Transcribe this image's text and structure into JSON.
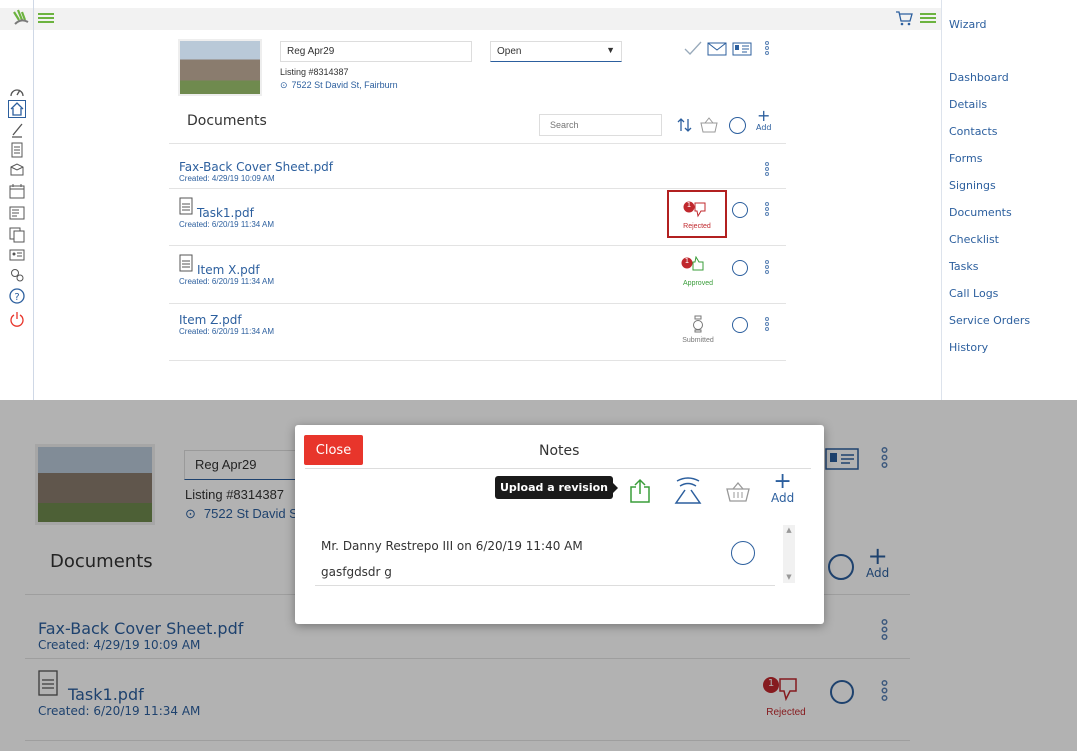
{
  "top": {
    "right_nav": [
      "Wizard",
      "Dashboard",
      "Details",
      "Contacts",
      "Forms",
      "Signings",
      "Documents",
      "Checklist",
      "Tasks",
      "Call Logs",
      "Service Orders",
      "History"
    ],
    "listing": {
      "name": "Reg Apr29",
      "status": "Open",
      "number": "Listing #8314387",
      "address": "7522 St David St, Fairburn"
    },
    "section_title": "Documents",
    "search_placeholder": "Search",
    "add_label": "Add",
    "documents": [
      {
        "title": "Fax-Back Cover Sheet.pdf",
        "created": "Created: 4/29/19 10:09 AM"
      },
      {
        "title": "Task1.pdf",
        "created": "Created: 6/20/19 11:34 AM",
        "status": "Rejected",
        "badge": "1"
      },
      {
        "title": "Item X.pdf",
        "created": "Created: 6/20/19 11:34 AM",
        "status": "Approved",
        "badge": "1"
      },
      {
        "title": "Item Z.pdf",
        "created": "Created: 6/20/19 11:34 AM",
        "status": "Submitted"
      }
    ]
  },
  "bottom": {
    "listing": {
      "name": "Reg Apr29",
      "number": "Listing #8314387",
      "address": "7522 St David S"
    },
    "section_title": "Documents",
    "add_label": "Add",
    "documents": [
      {
        "title": "Fax-Back Cover Sheet.pdf",
        "created": "Created: 4/29/19 10:09 AM"
      },
      {
        "title": "Task1.pdf",
        "created": "Created: 6/20/19 11:34 AM",
        "status": "Rejected",
        "badge": "1"
      }
    ],
    "modal": {
      "close_label": "Close",
      "title": "Notes",
      "tooltip": "Upload a revision",
      "add_label": "Add",
      "note_author": "Mr. Danny Restrepo III on 6/20/19 11:40 AM",
      "note_text": "gasfgdsdr g"
    }
  },
  "colors": {
    "accent": "#2c5f9e",
    "brand_green": "#6cb33f",
    "rejected": "#c0282d",
    "approved": "#3a9d3a",
    "close_red": "#e8352b"
  }
}
